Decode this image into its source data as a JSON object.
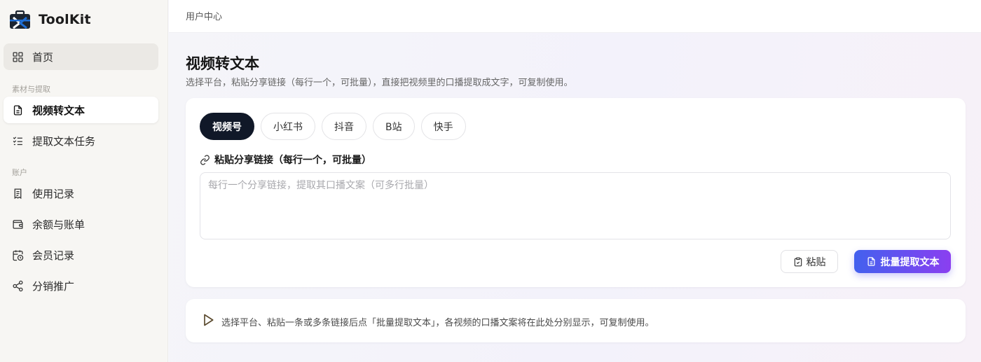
{
  "app": {
    "name": "ToolKit"
  },
  "sidebar": {
    "home": "首页",
    "section_material": "素材与提取",
    "video_to_text": "视频转文本",
    "extract_tasks": "提取文本任务",
    "section_account": "账户",
    "usage_records": "使用记录",
    "balance_billing": "余额与账单",
    "membership_records": "会员记录",
    "affiliate": "分销推广"
  },
  "header": {
    "breadcrumb": "用户中心"
  },
  "main": {
    "title": "视频转文本",
    "subtitle": "选择平台，粘贴分享链接（每行一个，可批量），直接把视频里的口播提取成文字，可复制使用。",
    "platform_tabs": [
      "视频号",
      "小红书",
      "抖音",
      "B站",
      "快手"
    ],
    "active_tab": "视频号",
    "input_label": "粘贴分享链接（每行一个，可批量）",
    "input_value": "",
    "input_placeholder": "每行一个分享链接，提取其口播文案（可多行批量）",
    "paste_button": "粘贴",
    "extract_button": "批量提取文本",
    "hint": "选择平台、粘贴一条或多条链接后点「批量提取文本」，各视频的口播文案将在此处分别显示，可复制使用。"
  },
  "colors": {
    "accent_start": "#4361ee",
    "accent_end": "#8b3ff0",
    "active_tab_bg": "#101828",
    "logo_blue": "#1f6fd6"
  }
}
